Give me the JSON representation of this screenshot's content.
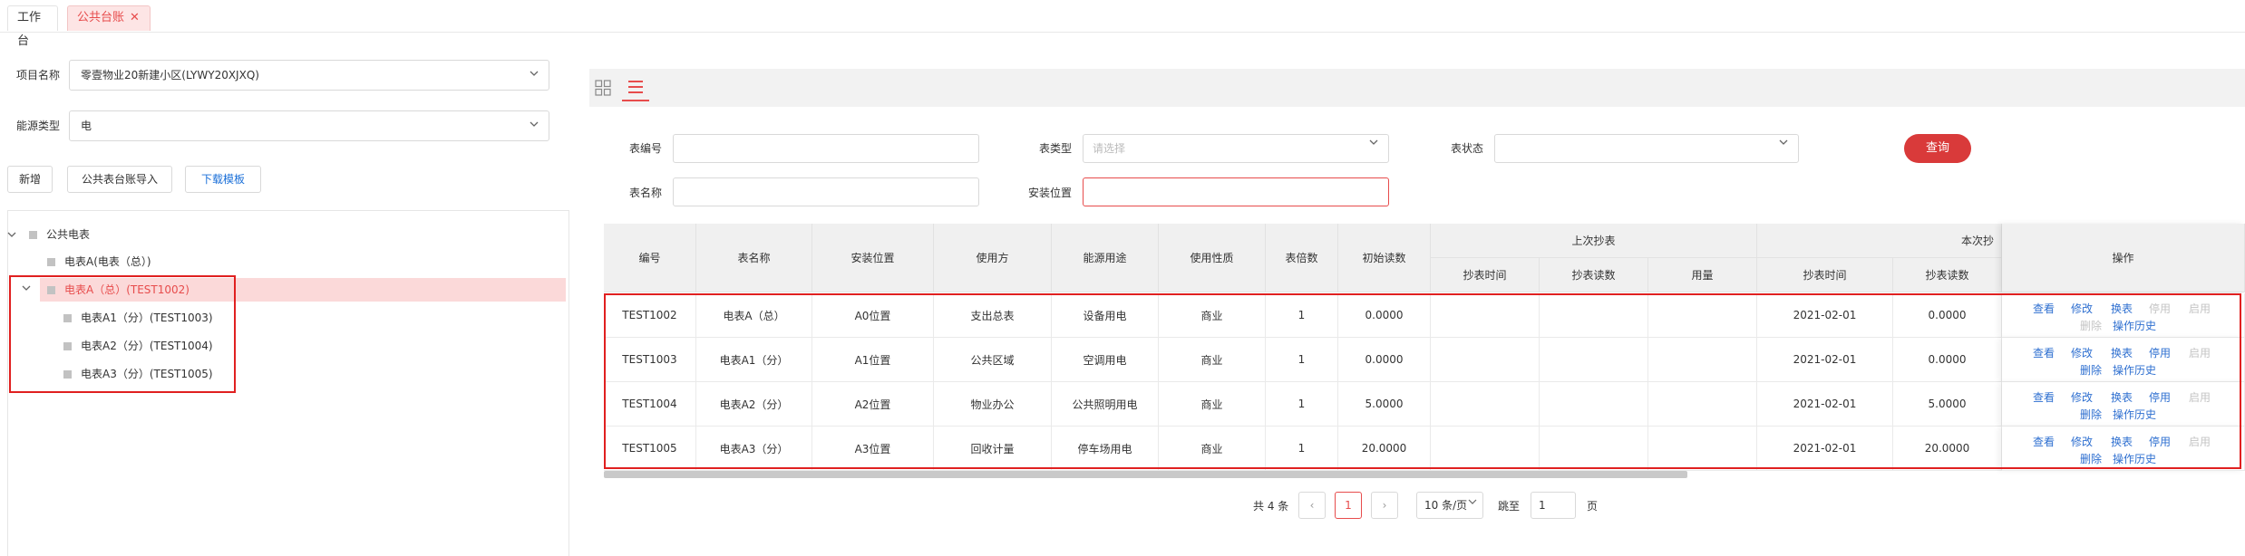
{
  "tabs": [
    {
      "label": "工作台"
    },
    {
      "label": "公共台账"
    }
  ],
  "left": {
    "project_label": "项目名称",
    "project_value": "零壹物业20新建小区(LYWY20XJXQ)",
    "energy_label": "能源类型",
    "energy_value": "电",
    "btn_add": "新增",
    "btn_import": "公共表台账导入",
    "btn_template": "下载模板",
    "tree": [
      {
        "label": "公共电表"
      },
      {
        "label": "电表A(电表（总）)"
      },
      {
        "label": "电表A（总）(TEST1002)"
      },
      {
        "label": "电表A1（分）(TEST1003)"
      },
      {
        "label": "电表A2（分）(TEST1004)"
      },
      {
        "label": "电表A3（分）(TEST1005)"
      }
    ]
  },
  "filters": {
    "meter_no_label": "表编号",
    "meter_type_label": "表类型",
    "meter_type_placeholder": "请选择",
    "meter_status_label": "表状态",
    "query_btn": "查询",
    "meter_name_label": "表名称",
    "install_label": "安装位置"
  },
  "table": {
    "headers": {
      "no": "编号",
      "name": "表名称",
      "install": "安装位置",
      "user": "使用方",
      "purpose": "能源用途",
      "nature": "使用性质",
      "ratio": "表倍数",
      "init": "初始读数",
      "last_group": "上次抄表",
      "last_time": "抄表时间",
      "last_read": "抄表读数",
      "usage": "用量",
      "this_group": "本次抄",
      "this_time": "抄表时间",
      "this_read": "抄表读数",
      "ops": "操作"
    },
    "rows": [
      {
        "no": "TEST1002",
        "name": "电表A（总）",
        "install": "A0位置",
        "user": "支出总表",
        "purpose": "设备用电",
        "nature": "商业",
        "ratio": "1",
        "init": "0.0000",
        "this_time": "2021-02-01",
        "this_read": "0.0000",
        "op_start_enabled": false
      },
      {
        "no": "TEST1003",
        "name": "电表A1（分）",
        "install": "A1位置",
        "user": "公共区域",
        "purpose": "空调用电",
        "nature": "商业",
        "ratio": "1",
        "init": "0.0000",
        "this_time": "2021-02-01",
        "this_read": "0.0000",
        "op_start_enabled": true
      },
      {
        "no": "TEST1004",
        "name": "电表A2（分）",
        "install": "A2位置",
        "user": "物业办公",
        "purpose": "公共照明用电",
        "nature": "商业",
        "ratio": "1",
        "init": "5.0000",
        "this_time": "2021-02-01",
        "this_read": "5.0000",
        "op_start_enabled": true
      },
      {
        "no": "TEST1005",
        "name": "电表A3（分）",
        "install": "A3位置",
        "user": "回收计量",
        "purpose": "停车场用电",
        "nature": "商业",
        "ratio": "1",
        "init": "20.0000",
        "this_time": "2021-02-01",
        "this_read": "20.0000",
        "op_start_enabled": true
      }
    ],
    "ops": {
      "view": "查看",
      "edit": "修改",
      "swap": "换表",
      "stop": "停用",
      "enable": "启用",
      "delete": "删除",
      "history": "操作历史"
    }
  },
  "pagination": {
    "total": "共 4 条",
    "current_page": "1",
    "page_size": "10 条/页",
    "goto_label": "跳至",
    "goto_value": "1",
    "page_suffix": "页"
  },
  "colors": {
    "accent": "#e74c4c",
    "link": "#2e6fd0",
    "highlight_box": "#e02020"
  }
}
